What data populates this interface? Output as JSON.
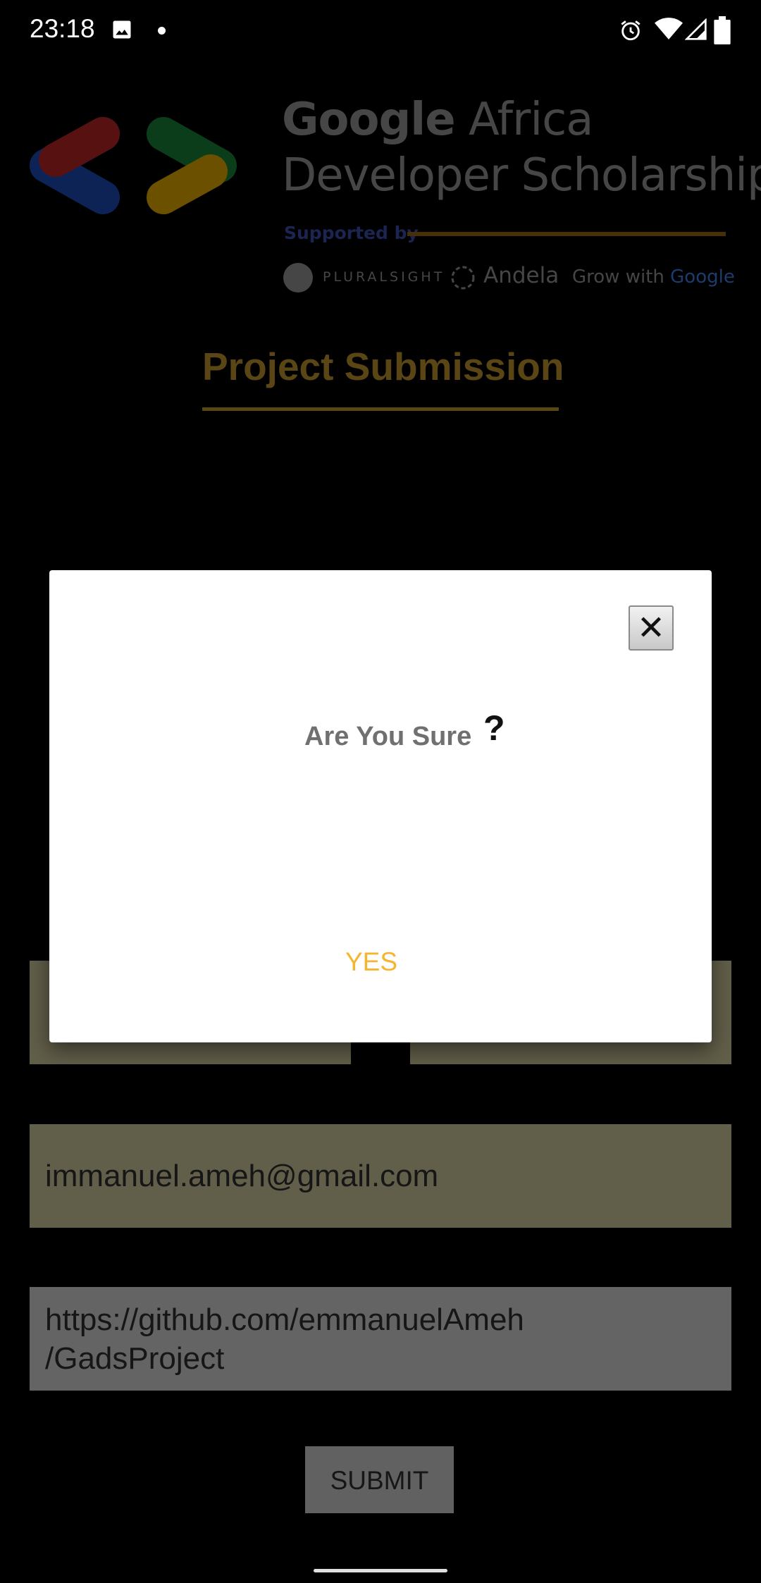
{
  "status_bar": {
    "time": "23:18"
  },
  "header": {
    "brand_google": "Google",
    "brand_africa": " Africa",
    "brand_line2": "Developer Scholarship",
    "supported_by": "Supported by",
    "sponsors": {
      "pluralsight": "PLURALSIGHT",
      "andela": "Andela",
      "grow_with": "Grow with ",
      "google": "Google"
    },
    "colors": {
      "red": "#c62828",
      "blue": "#1e4fbf",
      "green": "#1b8a3e",
      "yellow": "#f0b400"
    }
  },
  "page": {
    "title": "Project Submission"
  },
  "form": {
    "email": "immanuel.ameh@gmail.com",
    "link_line1": "https://github.com/emmanuelAmeh",
    "link_line2": "/GadsProject",
    "submit_label": "SUBMIT"
  },
  "dialog": {
    "message": "Are You Sure",
    "question_mark": "?",
    "close_glyph": "✕",
    "yes_label": "YES",
    "accent": "#f5b52e"
  }
}
